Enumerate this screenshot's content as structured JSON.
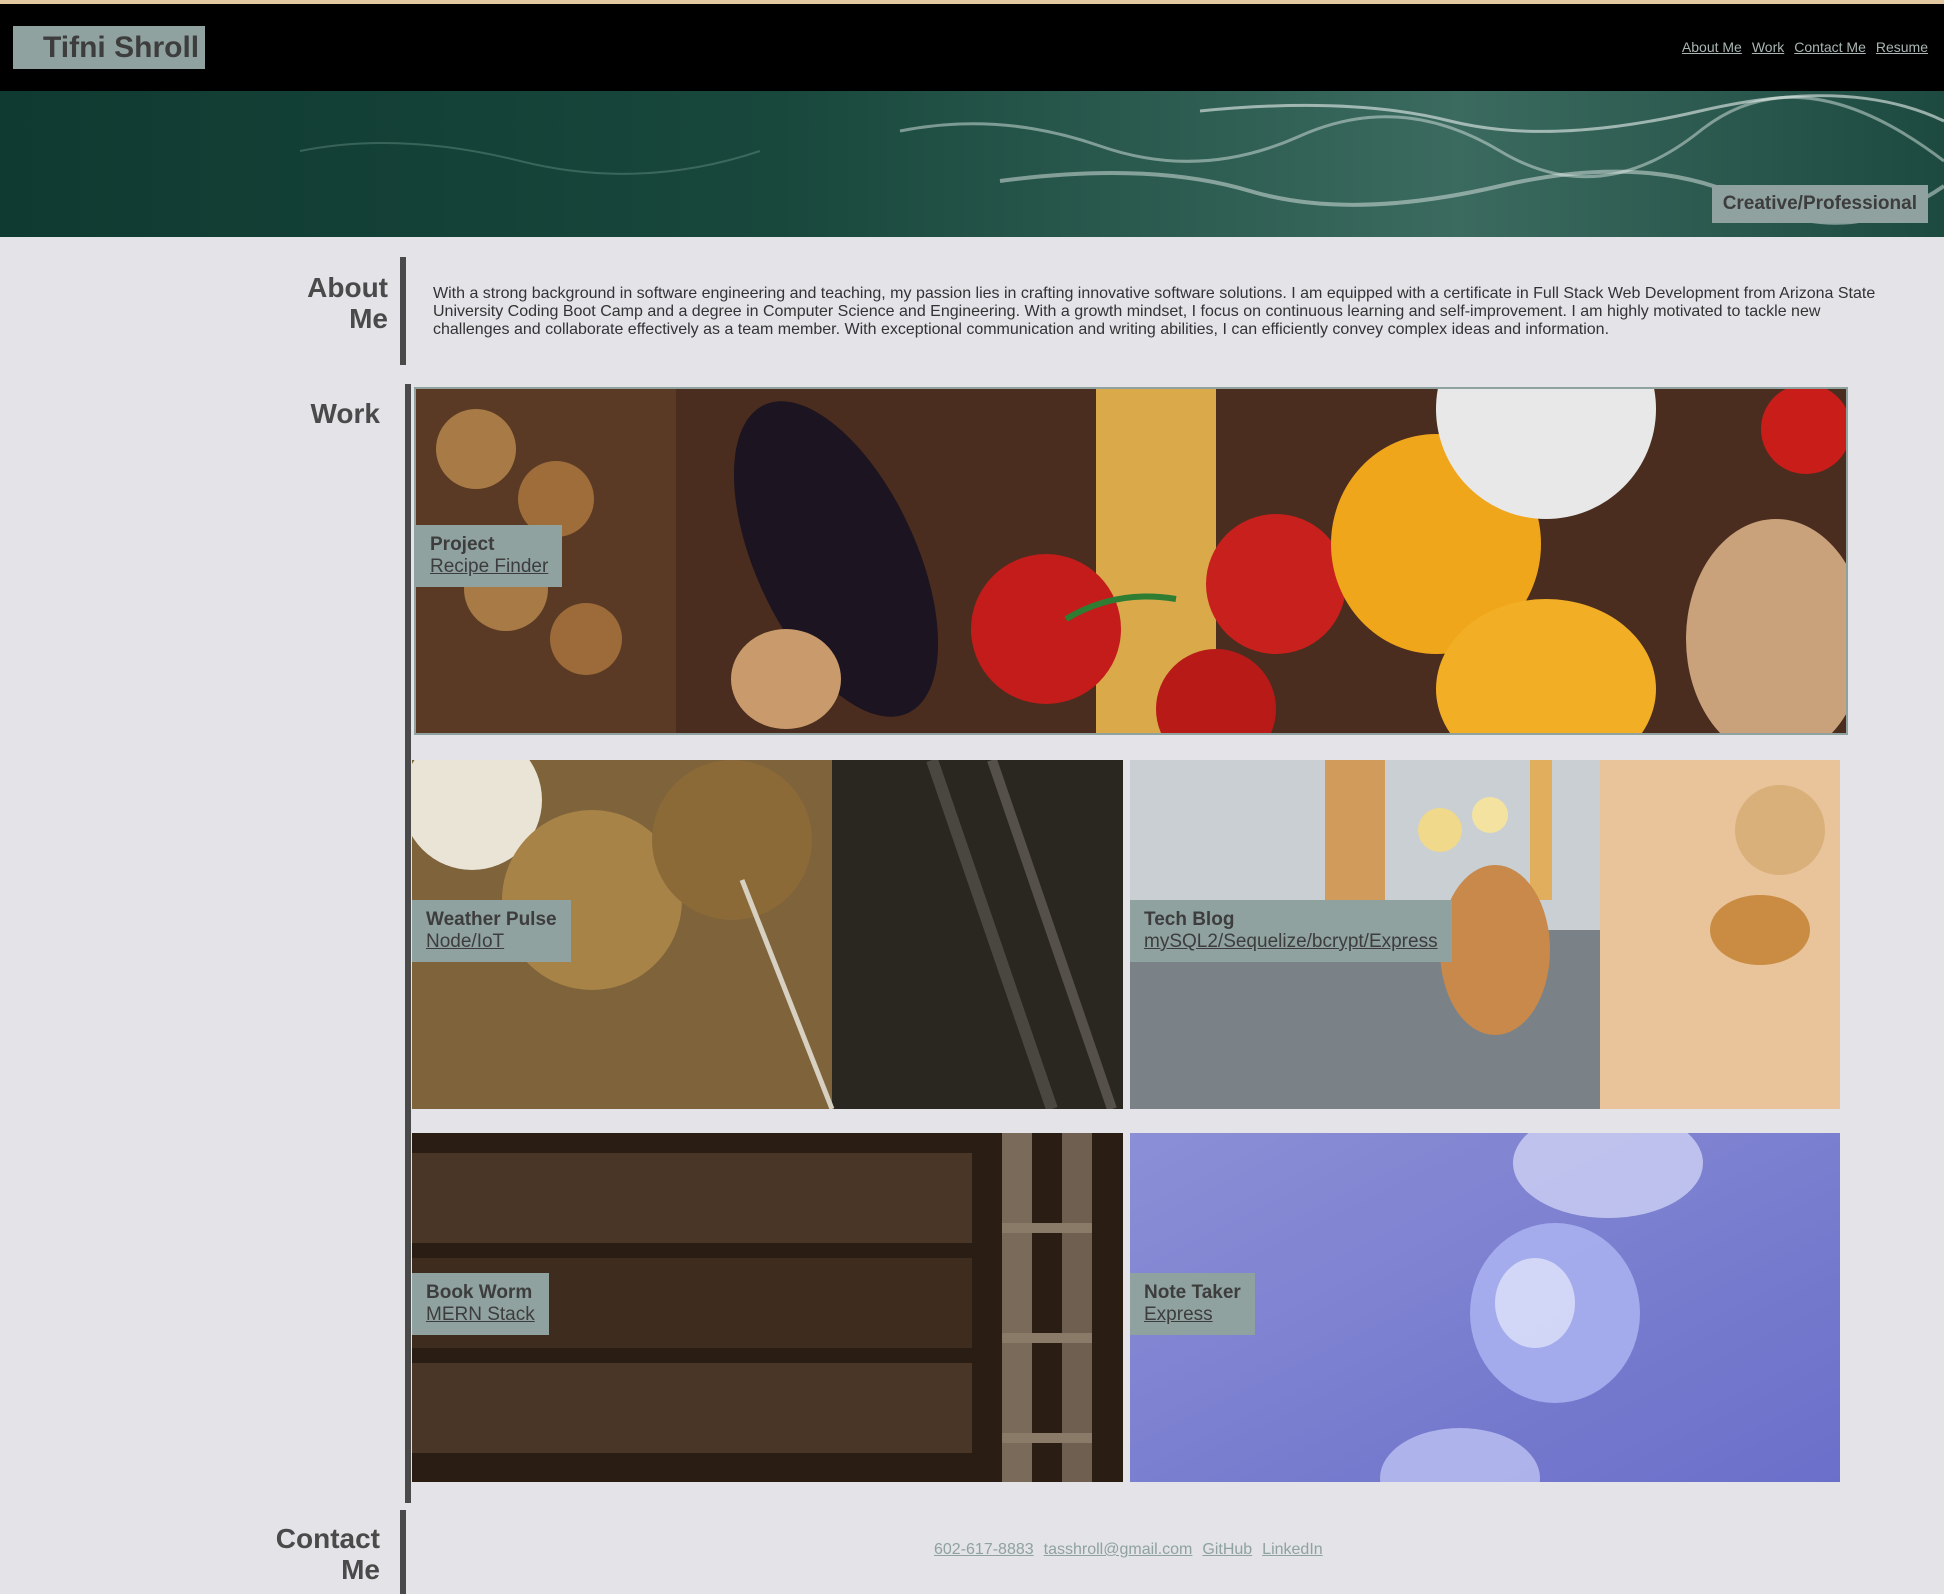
{
  "header": {
    "brand": "Tifni Shroll",
    "nav": [
      "About Me",
      "Work",
      "Contact Me",
      "Resume"
    ]
  },
  "hero": {
    "tagline": "Creative/Professional"
  },
  "about": {
    "title_line1": "About",
    "title_line2": "Me",
    "text": "With a strong background in software engineering and teaching, my passion lies in crafting innovative software solutions. I am equipped with a certificate in Full Stack Web Development from Arizona State University Coding Boot Camp and a degree in Computer Science and Engineering. With a growth mindset, I focus on continuous learning and self-improvement. I am highly motivated to tackle new challenges and collaborate effectively as a team member. With exceptional communication and writing abilities, I can efficiently convey complex ideas and information."
  },
  "work": {
    "title": "Work",
    "projects": [
      {
        "name": "Project",
        "link": "Recipe Finder"
      },
      {
        "name": "Weather Pulse",
        "link": "Node/IoT"
      },
      {
        "name": "Tech Blog",
        "link": "mySQL2/Sequelize/bcrypt/Express"
      },
      {
        "name": "Book Worm",
        "link": "MERN Stack"
      },
      {
        "name": "Note Taker",
        "link": "Express"
      }
    ]
  },
  "contact": {
    "title_line1": "Contact",
    "title_line2": "Me",
    "links": [
      "602-617-8883",
      "tasshroll@gmail.com",
      "GitHub",
      "LinkedIn"
    ]
  },
  "colors": {
    "page_bg": "#e3e3e8",
    "accent_sage": "#8fa29f",
    "header_bg": "#000000",
    "text_dark": "#4a4a4a"
  }
}
